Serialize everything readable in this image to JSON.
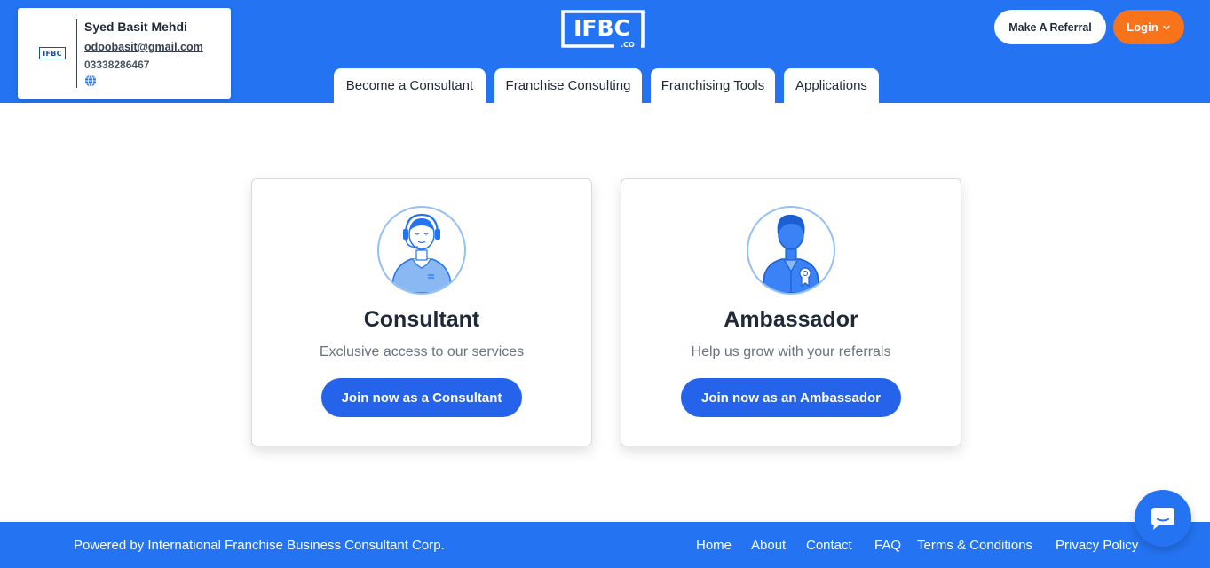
{
  "profile": {
    "logo_text": "IFBC",
    "name": "Syed Basit Mehdi",
    "email": "odoobasit@gmail.com",
    "phone": "03338286467",
    "website_icon": "globe-icon"
  },
  "header": {
    "brand_main": "IFBC",
    "brand_sub": ".CO",
    "brand_tm": "™",
    "referral_label": "Make A Referral",
    "login_label": "Login",
    "login_icon": "chevron-down-icon"
  },
  "tabs": [
    {
      "label": "Become a Consultant"
    },
    {
      "label": "Franchise Consulting"
    },
    {
      "label": "Franchising Tools"
    },
    {
      "label": "Applications"
    }
  ],
  "cards": [
    {
      "title": "Consultant",
      "subtitle": "Exclusive access to our services",
      "button": "Join now as a Consultant",
      "icon": "consultant-headset-icon"
    },
    {
      "title": "Ambassador",
      "subtitle": "Help us grow with your referrals",
      "button": "Join now as an Ambassador",
      "icon": "ambassador-badge-icon"
    }
  ],
  "footer": {
    "powered_by": "Powered by International Franchise Business Consultant Corp.",
    "links": [
      "Home",
      "About",
      "Contact",
      "FAQ",
      "Terms & Conditions",
      "Privacy Policy"
    ]
  },
  "chat": {
    "icon": "chat-bubble-icon"
  },
  "colors": {
    "header_blue": "#2473f2",
    "button_blue": "#2563eb",
    "login_orange": "#f9731b",
    "avatar_light_blue": "#93c0f5"
  }
}
